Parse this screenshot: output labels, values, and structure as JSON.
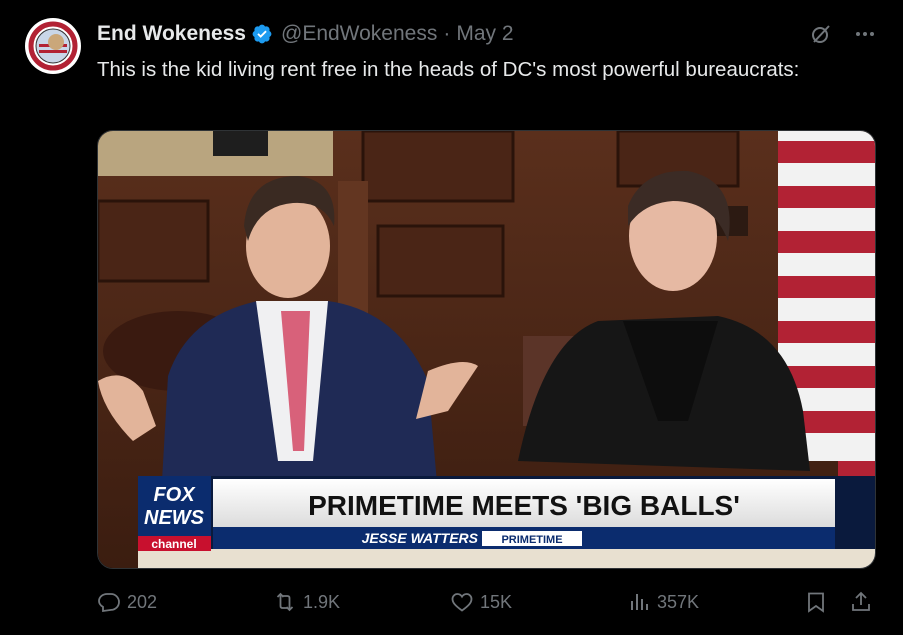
{
  "tweet": {
    "author_name": "End Wokeness",
    "author_handle": "@EndWokeness",
    "separator": "·",
    "date": "May 2",
    "text": "This is the kid living rent free in the heads of DC's most powerful bureaucrats:",
    "avatar_icon": "avatar-badge-icon",
    "verified_color": "#1d9bf0"
  },
  "media": {
    "chyron_headline": "PRIMETIME MEETS 'BIG BALLS'",
    "chyron_show_prefix": "JESSE WATTERS",
    "chyron_show_suffix": "PRIMETIME",
    "network_logo_line1": "FOX",
    "network_logo_line2": "NEWS",
    "network_logo_line3": "channel"
  },
  "stats": {
    "replies": "202",
    "reposts": "1.9K",
    "likes": "15K",
    "views": "357K"
  }
}
